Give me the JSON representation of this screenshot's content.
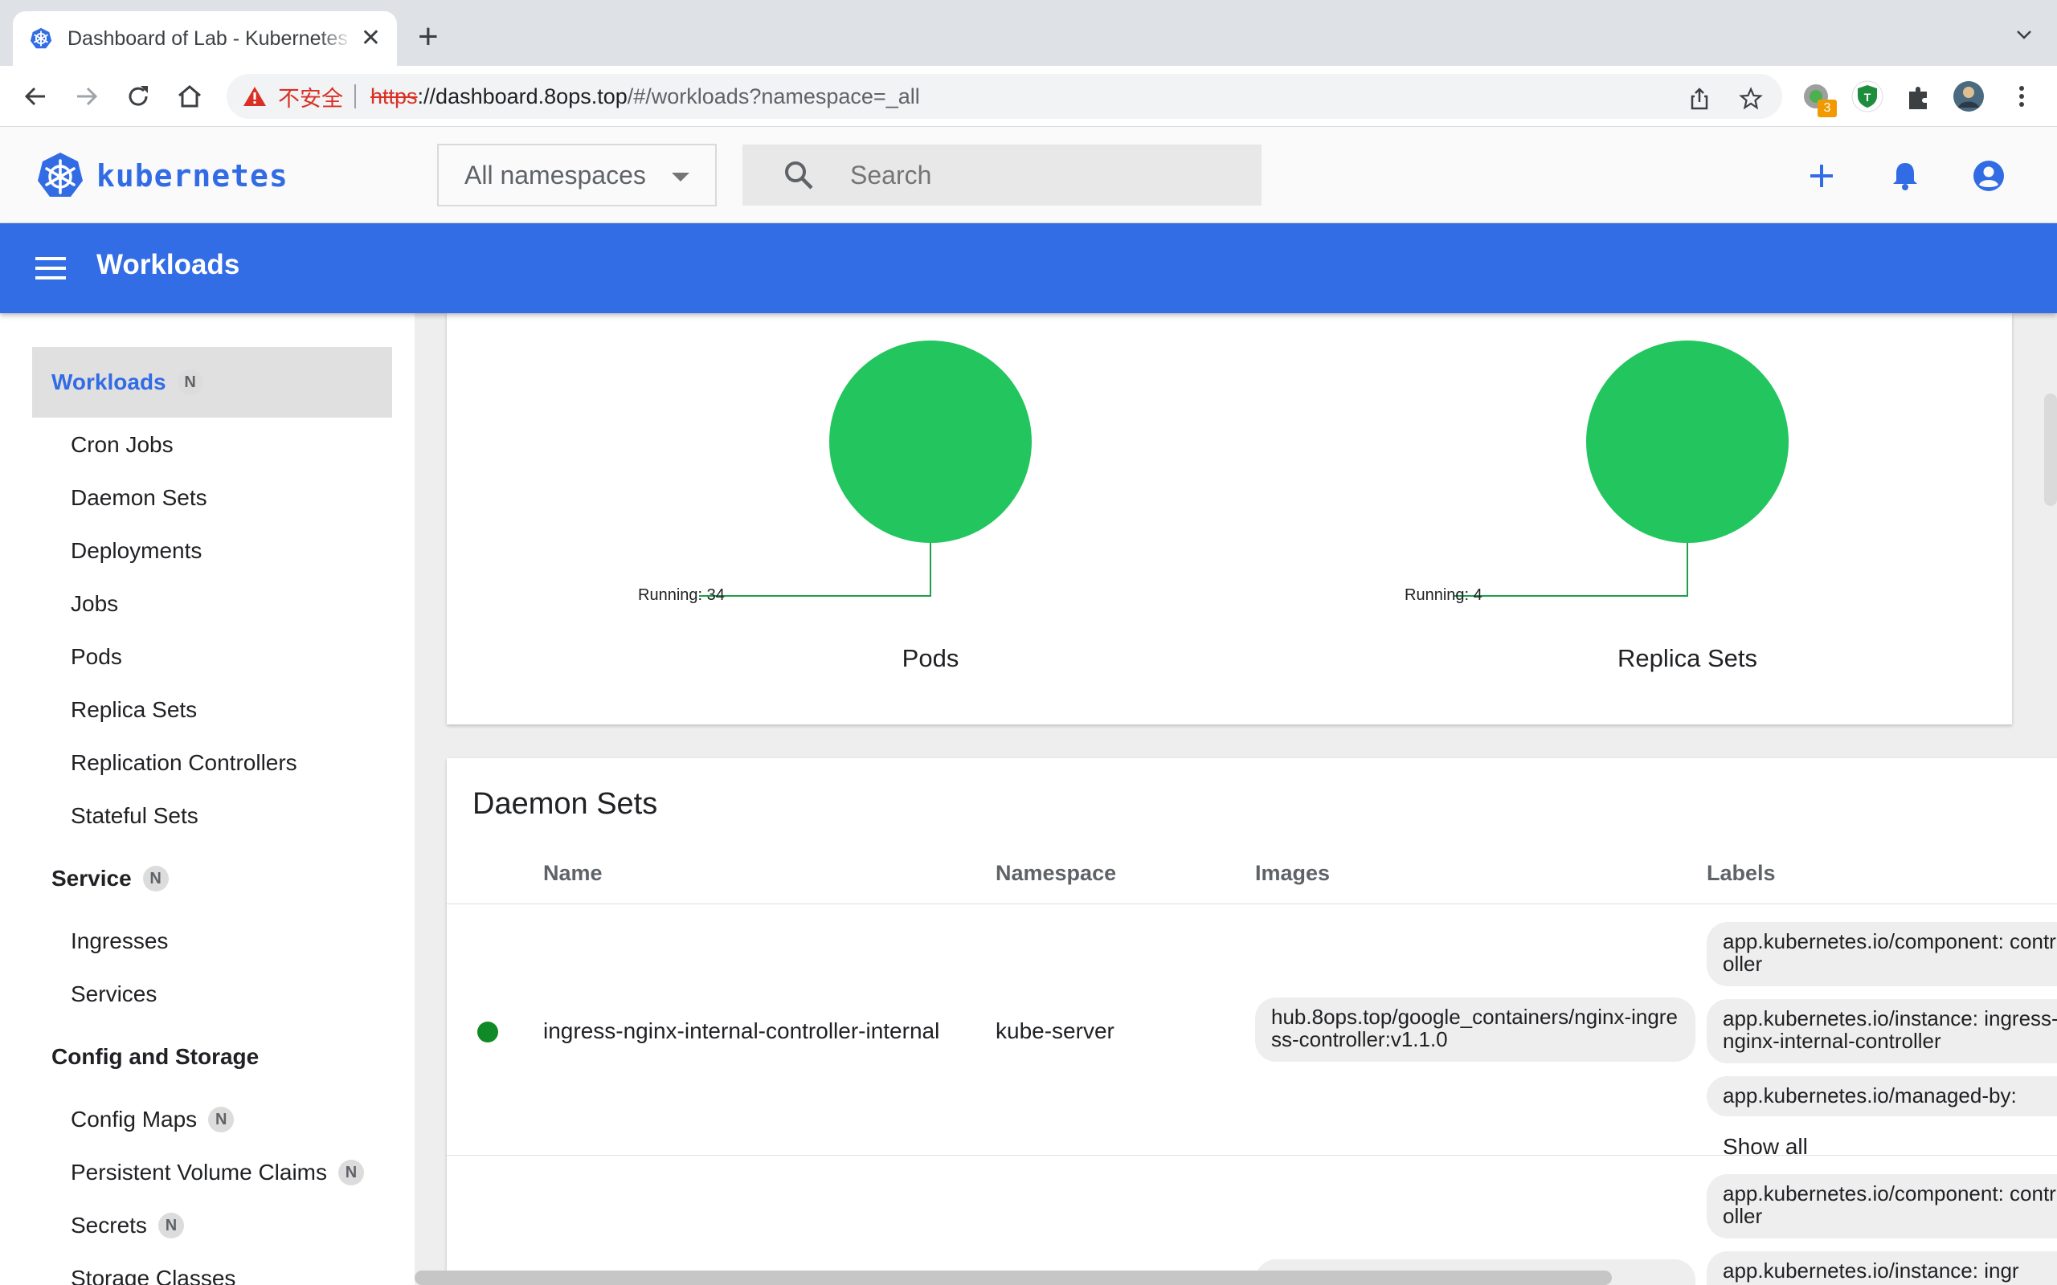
{
  "browser": {
    "tab_title": "Dashboard of Lab - Kubernetes",
    "insecure_label": "不安全",
    "url_scheme": "https",
    "url_host": "://dashboard.8ops.top",
    "url_path": "/#/workloads?namespace=_all",
    "extension_badge": "3"
  },
  "header": {
    "brand": "kubernetes",
    "namespace_select": "All namespaces",
    "search_placeholder": "Search"
  },
  "toolbar": {
    "title": "Workloads"
  },
  "sidebar": {
    "workloads": {
      "label": "Workloads",
      "badge": "N"
    },
    "workload_items": [
      "Cron Jobs",
      "Daemon Sets",
      "Deployments",
      "Jobs",
      "Pods",
      "Replica Sets",
      "Replication Controllers",
      "Stateful Sets"
    ],
    "service": {
      "label": "Service",
      "badge": "N"
    },
    "service_items": [
      "Ingresses",
      "Services"
    ],
    "config": {
      "label": "Config and Storage"
    },
    "config_items": [
      {
        "label": "Config Maps",
        "badge": "N"
      },
      {
        "label": "Persistent Volume Claims",
        "badge": "N"
      },
      {
        "label": "Secrets",
        "badge": "N"
      },
      {
        "label": "Storage Classes"
      }
    ]
  },
  "charts": [
    {
      "title": "Pods",
      "label": "Running: 34",
      "status_color": "#22c55e"
    },
    {
      "title": "Replica Sets",
      "label": "Running: 4",
      "status_color": "#22c55e"
    }
  ],
  "daemon_sets": {
    "title": "Daemon Sets",
    "columns": [
      "Name",
      "Namespace",
      "Images",
      "Labels"
    ],
    "rows": [
      {
        "name": "ingress-nginx-internal-controller-internal",
        "namespace": "kube-server",
        "image": "hub.8ops.top/google_containers/nginx-ingress-controller:v1.1.0",
        "labels": [
          "app.kubernetes.io/component: controller",
          "app.kubernetes.io/instance: ingress-nginx-internal-controller",
          "app.kubernetes.io/managed-by: "
        ],
        "show_all": "Show all"
      },
      {
        "labels": [
          "app.kubernetes.io/component: controller",
          "app.kubernetes.io/instance: ingr"
        ]
      }
    ]
  }
}
